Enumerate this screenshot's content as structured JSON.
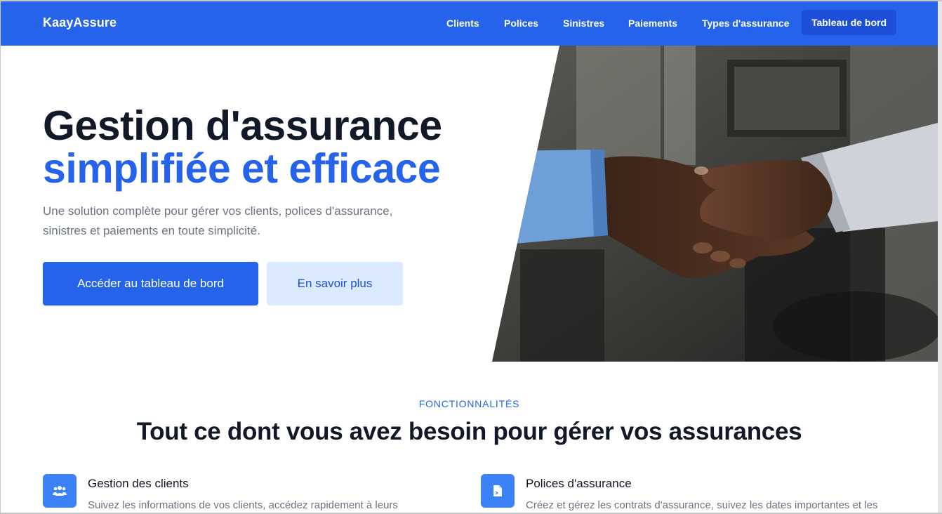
{
  "nav": {
    "brand": "KaayAssure",
    "items": [
      "Clients",
      "Polices",
      "Sinistres",
      "Paiements",
      "Types d'assurance"
    ],
    "cta": "Tableau de bord"
  },
  "hero": {
    "title_line1": "Gestion d'assurance",
    "title_line2": "simplifiée et efficace",
    "subtitle": "Une solution complète pour gérer vos clients, polices d'assurance, sinistres et paiements en toute simplicité.",
    "primary_button": "Accéder au tableau de bord",
    "secondary_button": "En savoir plus"
  },
  "features_section": {
    "eyebrow": "FONCTIONNALITÉS",
    "title": "Tout ce dont vous avez besoin pour gérer vos assurances",
    "items": [
      {
        "icon": "users-icon",
        "title": "Gestion des clients",
        "description": "Suivez les informations de vos clients, accédez rapidement à leurs"
      },
      {
        "icon": "document-icon",
        "title": "Polices d'assurance",
        "description": "Créez et gérez les contrats d'assurance, suivez les dates importantes et les"
      }
    ]
  },
  "colors": {
    "primary": "#2563eb",
    "primary_dark": "#1d4ed8",
    "secondary_bg": "#dbeafe",
    "heading": "#111827",
    "muted": "#6b7280"
  }
}
